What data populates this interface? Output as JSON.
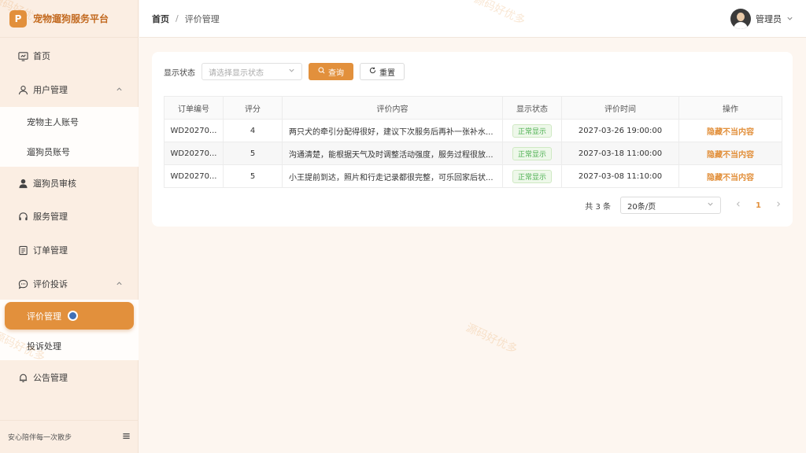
{
  "brand": {
    "logo": "P",
    "title": "宠物遛狗服务平台"
  },
  "nav": {
    "home": "首页",
    "user_mgmt": "用户管理",
    "user_sub": [
      "宠物主人账号",
      "遛狗员账号"
    ],
    "walker_review": "遛狗员审核",
    "service_mgmt": "服务管理",
    "order_mgmt": "订单管理",
    "review_complaint": "评价投诉",
    "review_sub_active": "评价管理",
    "complaint_handle": "投诉处理",
    "notice_mgmt": "公告管理"
  },
  "footer": {
    "slogan": "安心陪伴每一次散步"
  },
  "header": {
    "breadcrumb_home": "首页",
    "breadcrumb_sep": "/",
    "breadcrumb_current": "评价管理",
    "user_name": "管理员"
  },
  "filter": {
    "label": "显示状态",
    "placeholder": "请选择显示状态",
    "query_label": "查询",
    "reset_label": "重置"
  },
  "table": {
    "columns": [
      "订单编号",
      "评分",
      "评价内容",
      "显示状态",
      "评价时间",
      "操作"
    ],
    "rows": [
      {
        "order": "WD20270...",
        "score": "4",
        "content": "两只犬的牵引分配得很好，建议下次服务后再补一张补水...",
        "status": "正常显示",
        "time": "2027-03-26 19:00:00",
        "action": "隐藏不当内容"
      },
      {
        "order": "WD20270...",
        "score": "5",
        "content": "沟通清楚，能根据天气及时调整活动强度，服务过程很放...",
        "status": "正常显示",
        "time": "2027-03-18 11:00:00",
        "action": "隐藏不当内容"
      },
      {
        "order": "WD20270...",
        "score": "5",
        "content": "小王提前到达，照片和行走记录都很完整，可乐回家后状...",
        "status": "正常显示",
        "time": "2027-03-08 11:10:00",
        "action": "隐藏不当内容"
      }
    ]
  },
  "pagination": {
    "total": "共 3 条",
    "page_size": "20条/页",
    "current": "1"
  },
  "watermark": "源码好优多",
  "colors": {
    "accent": "#e2903c",
    "sidebar_bg": "#fbeee3",
    "page_bg": "#fdf6f0",
    "status_green": "#4caf50"
  }
}
